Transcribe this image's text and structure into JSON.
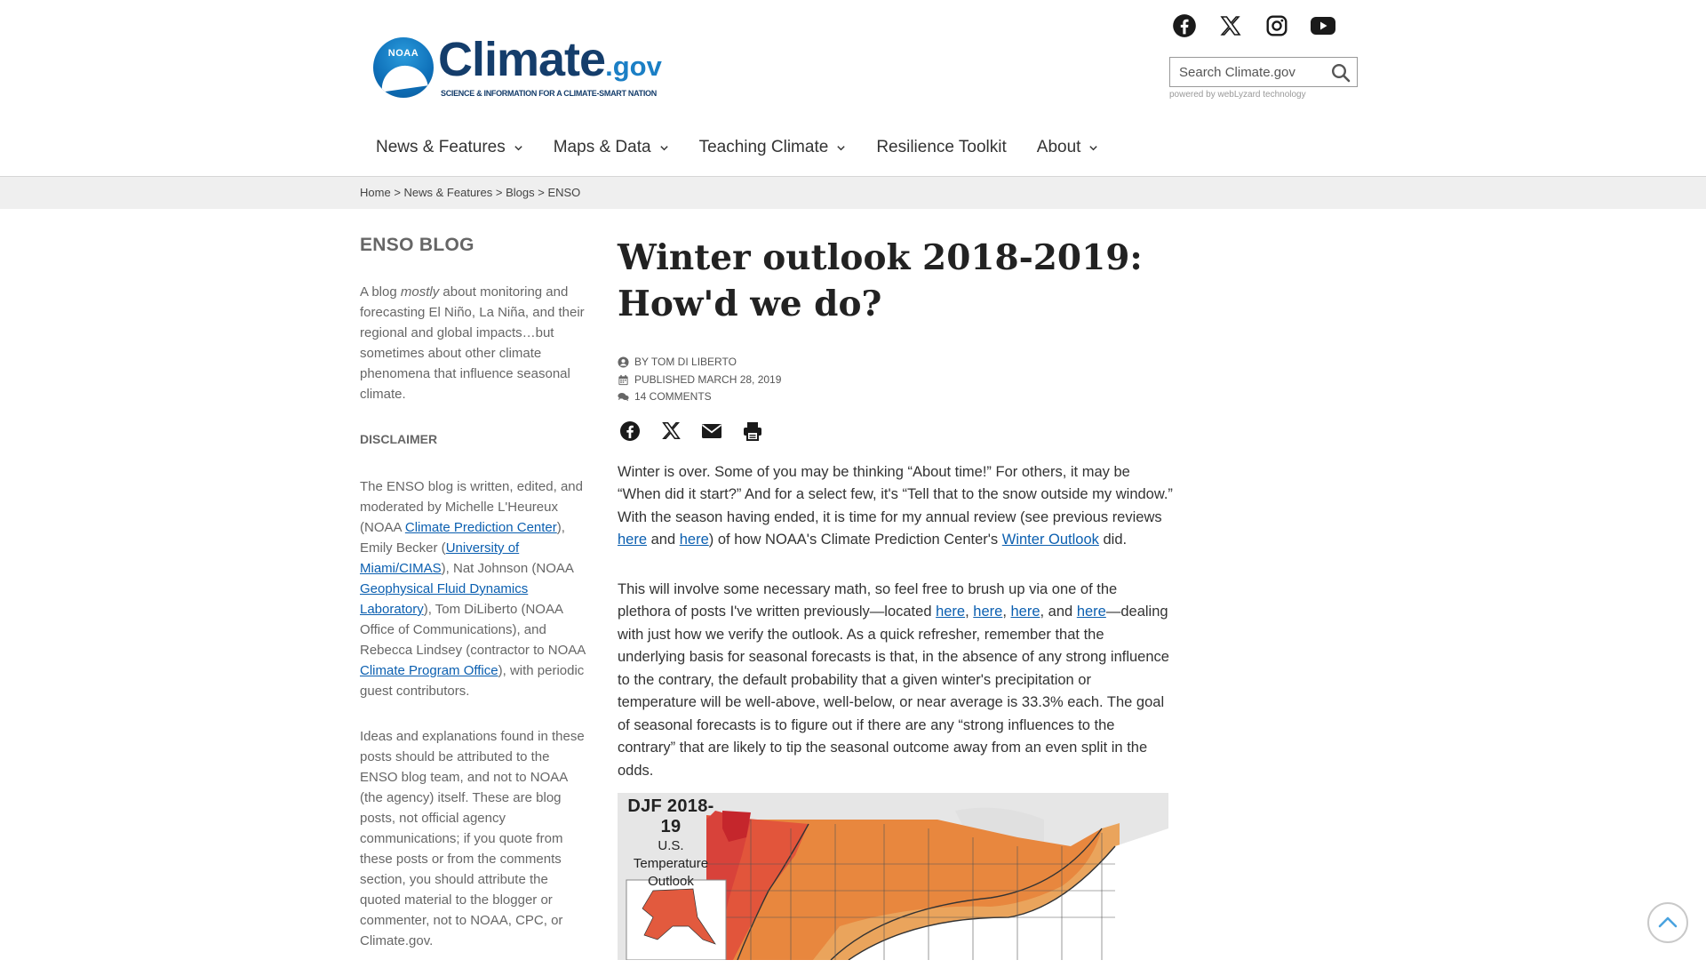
{
  "logo": {
    "badge": "NOAA",
    "word": "Climate",
    "tld": ".gov",
    "tagline": "SCIENCE & INFORMATION FOR A CLIMATE-SMART NATION"
  },
  "social": {
    "icons": [
      "facebook-icon",
      "x-icon",
      "instagram-icon",
      "youtube-icon"
    ]
  },
  "search": {
    "placeholder": "Search Climate.gov",
    "powered_by": "powered by webLyzard technology"
  },
  "nav": {
    "items": [
      {
        "label": "News & Features",
        "dropdown": true
      },
      {
        "label": "Maps & Data",
        "dropdown": true
      },
      {
        "label": "Teaching Climate",
        "dropdown": true
      },
      {
        "label": "Resilience Toolkit",
        "dropdown": false
      },
      {
        "label": "About",
        "dropdown": true
      }
    ]
  },
  "breadcrumb": {
    "items": [
      "Home",
      "News & Features",
      "Blogs",
      "ENSO"
    ],
    "separator": ">"
  },
  "sidebar": {
    "title": "ENSO BLOG",
    "intro_before": "A blog ",
    "intro_em": "mostly",
    "intro_after": " about monitoring and forecasting El Niño, La Niña, and their regional and global impacts…but sometimes about other climate phenomena that influence seasonal climate.",
    "disclaimer_heading": "DISCLAIMER",
    "disclaimer_p1": {
      "t1": "The ENSO blog is written, edited, and moderated by Michelle L'Heureux (NOAA ",
      "l1": "Climate Prediction Center",
      "t2": "), Emily Becker (",
      "l2": "University of Miami/CIMAS",
      "t3": "), Nat Johnson (NOAA ",
      "l3": "Geophysical Fluid Dynamics Laboratory",
      "t4": "), Tom DiLiberto (NOAA Office of Communications), and Rebecca Lindsey (contractor to NOAA ",
      "l4": "Climate Program Office",
      "t5": "), with periodic guest contributors."
    },
    "disclaimer_p2": "Ideas and explanations found in these posts should be attributed to the ENSO blog team, and not to NOAA (the agency) itself. These are blog posts, not official agency communications; if you quote from these posts or from the comments section, you should attribute the quoted material to the blogger or commenter, not to NOAA, CPC, or Climate.gov."
  },
  "article": {
    "title": "Winter outlook 2018-2019: How'd we do?",
    "author": "BY TOM DI LIBERTO",
    "published": "PUBLISHED MARCH 28, 2019",
    "comments": "14 COMMENTS",
    "share_icons": [
      "facebook-icon",
      "x-icon",
      "email-icon",
      "print-icon"
    ],
    "p1": {
      "t1": "Winter is over. Some of you may be thinking “About time!” For others, it may be “When did it start?” And for a select few, it's “Tell that to the snow outside my window.” With the season having ended, it is time for my annual review (see previous reviews",
      "l1": " here",
      "t2": " and ",
      "l2": "here",
      "t3": ") of how NOAA's Climate Prediction Center's ",
      "l3": "Winter Outlook",
      "t4": " did."
    },
    "p2": {
      "t1": "This will involve some necessary math, so feel free to brush up via one of the plethora of posts I've written previously—located ",
      "l1": "here",
      "c1": ", ",
      "l2": "here",
      "c2": ", ",
      "l3": "here",
      "c3": ", and ",
      "l4": "here",
      "t2": "—dealing with just how we verify the outlook. As a quick refresher, remember that the underlying basis for seasonal forecasts is that, in the absence of any strong influence to the contrary, the default probability that a given winter's precipitation or temperature will be well-above, well-below, or near average is 33.3% each. The goal of seasonal forecasts is to figure out if there are any “strong influences to the contrary” that are likely to tip the seasonal outcome away from an even split in the odds."
    }
  },
  "map": {
    "title": "DJF 2018-19",
    "subtitle": [
      "U.S.",
      "Temperature",
      "Outlook"
    ],
    "colors": {
      "land_bg": "#e6e6e6",
      "above_dark": "#c5262c",
      "above_mid": "#e2553b",
      "above_light": "#e8873e",
      "above_lighter": "#eaa45c",
      "alaska": "#e25a3e"
    }
  },
  "back_to_top": {
    "icon": "chevron-up-icon"
  }
}
